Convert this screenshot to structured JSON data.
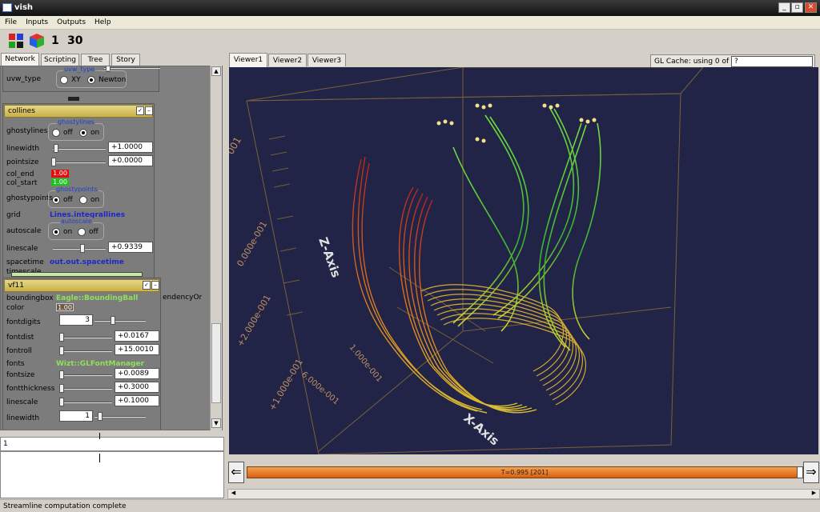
{
  "window": {
    "title": "vish"
  },
  "menu": [
    "File",
    "Inputs",
    "Outputs",
    "Help"
  ],
  "toolbar": {
    "num1": "1",
    "num2": "30"
  },
  "left_tabs": [
    "Network",
    "Scripting",
    "Tree",
    "Story"
  ],
  "top_node": {
    "partial_label": "uvw_type",
    "group_title": "uvw_type",
    "options": [
      "XY",
      "Newton"
    ],
    "selected": "Newton"
  },
  "collines": {
    "title": "collines",
    "ghostylines_label": "ghostylines",
    "ghostylines_group": "ghostylines",
    "ghostylines_options": [
      "off",
      "on"
    ],
    "linewidth_label": "linewidth",
    "linewidth_value": "+1.0000",
    "pointsize_label": "pointsize",
    "pointsize_value": "+0.0000",
    "col_end_label": "col_end",
    "col_end_value": "1.00",
    "col_start_label": "col_start",
    "col_start_value": "1.00",
    "ghostypoints_label": "ghostypoints",
    "ghostypoints_group": "ghostypoints",
    "ghostypoints_options": [
      "off",
      "on"
    ],
    "grid_label": "grid",
    "grid_value": "Lines.integrallines",
    "autoscale_label": "autoscale",
    "autoscale_group": "autoscale",
    "autoscale_options": [
      "on",
      "off"
    ],
    "linescale_label": "linescale",
    "linescale_value": "+0.9339",
    "spacetime_label": "spacetime",
    "spacetime_value": "out.out.spacetime",
    "timescale_label": "timescale"
  },
  "vf11": {
    "title": "vf11",
    "side_text": "endencyOr",
    "boundingbox_label": "boundingbox",
    "boundingbox_value": "Eagle::BoundingBall",
    "color_label": "color",
    "color_value": "1.00",
    "fontdigits_label": "fontdigits",
    "fontdigits_value": "3",
    "fontdist_label": "fontdist",
    "fontdist_value": "+0.0167",
    "fontroll_label": "fontroll",
    "fontroll_value": "+15.0010",
    "fonts_label": "fonts",
    "fonts_value": "Wizt::GLFontManager",
    "fontsize_label": "fontsize",
    "fontsize_value": "+0.0089",
    "fontthickness_label": "fontthickness",
    "fontthickness_value": "+0.3000",
    "linescale_label": "linescale",
    "linescale_value": "+0.1000",
    "linewidth_label": "linewidth",
    "linewidth_value": "1"
  },
  "bottom_left": {
    "line1": "1"
  },
  "viewer_tabs": [
    "Viewer1",
    "Viewer2",
    "Viewer3"
  ],
  "gl_cache": {
    "label": "GL Cache: using  0  of",
    "input": "?"
  },
  "axes": {
    "z_label": "Z-Axis",
    "x_label": "X-Axis",
    "t1": "001",
    "t2": "0.000e-001",
    "t3": "+2.000e-001",
    "t4": "1.000e-001",
    "t5": "+1.000e-001",
    "t6": "6.000e-001"
  },
  "time": {
    "label": "T=0.995 [201]",
    "fraction": 0.995
  },
  "status": "Streamline computation complete",
  "colors": {
    "accent": "#e0701c",
    "viewer_bg": "#212446",
    "node_header": "#d8c468"
  }
}
